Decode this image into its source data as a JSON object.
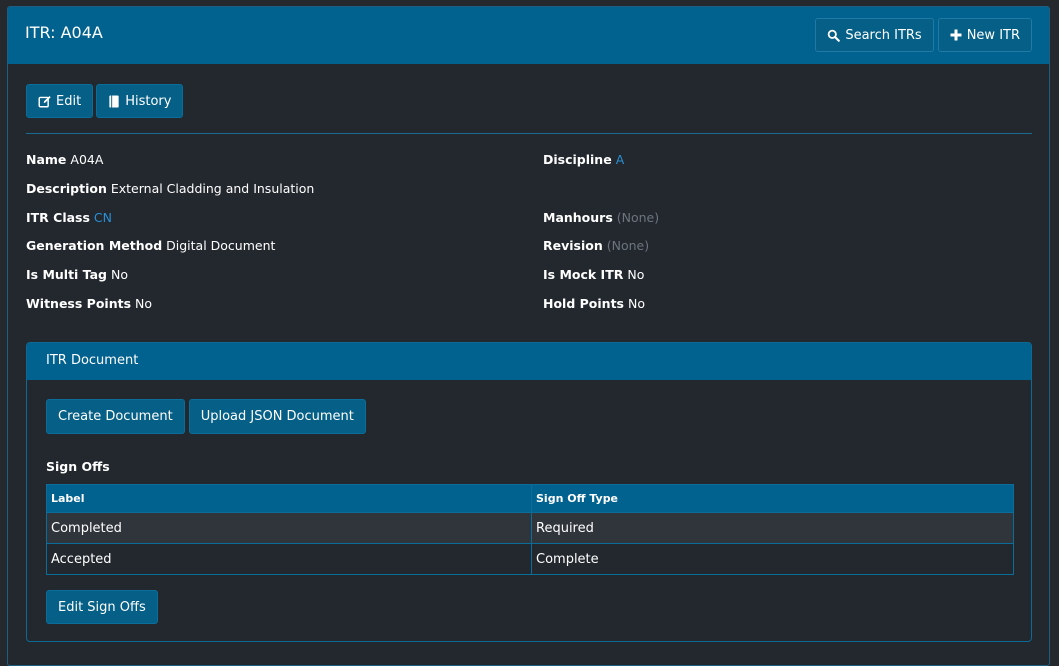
{
  "header": {
    "title": "ITR: A04A",
    "search_label": "Search ITRs",
    "new_label": "New ITR"
  },
  "actions": {
    "edit_label": "Edit",
    "history_label": "History"
  },
  "fields": {
    "name": {
      "label": "Name",
      "value": "A04A"
    },
    "discipline": {
      "label": "Discipline",
      "value": "A"
    },
    "description": {
      "label": "Description",
      "value": "External Cladding and Insulation"
    },
    "itr_class": {
      "label": "ITR Class",
      "value": "CN"
    },
    "manhours": {
      "label": "Manhours",
      "value": "(None)"
    },
    "generation_method": {
      "label": "Generation Method",
      "value": "Digital Document"
    },
    "revision": {
      "label": "Revision",
      "value": "(None)"
    },
    "is_multi_tag": {
      "label": "Is Multi Tag",
      "value": "No"
    },
    "is_mock_itr": {
      "label": "Is Mock ITR",
      "value": "No"
    },
    "witness_points": {
      "label": "Witness Points",
      "value": "No"
    },
    "hold_points": {
      "label": "Hold Points",
      "value": "No"
    }
  },
  "document": {
    "title": "ITR Document",
    "create_label": "Create Document",
    "upload_label": "Upload JSON Document",
    "signoffs_title": "Sign Offs",
    "columns": [
      "Label",
      "Sign Off Type"
    ],
    "rows": [
      [
        "Completed",
        "Required"
      ],
      [
        "Accepted",
        "Complete"
      ]
    ],
    "edit_signoffs_label": "Edit Sign Offs"
  },
  "icons": {
    "search": "search-icon",
    "plus": "plus-icon",
    "edit": "edit-icon",
    "history": "book-icon"
  },
  "colors": {
    "header_bg": "#02628f",
    "page_bg": "#22282e",
    "link": "#2a8fd3",
    "muted": "#6c757d"
  }
}
